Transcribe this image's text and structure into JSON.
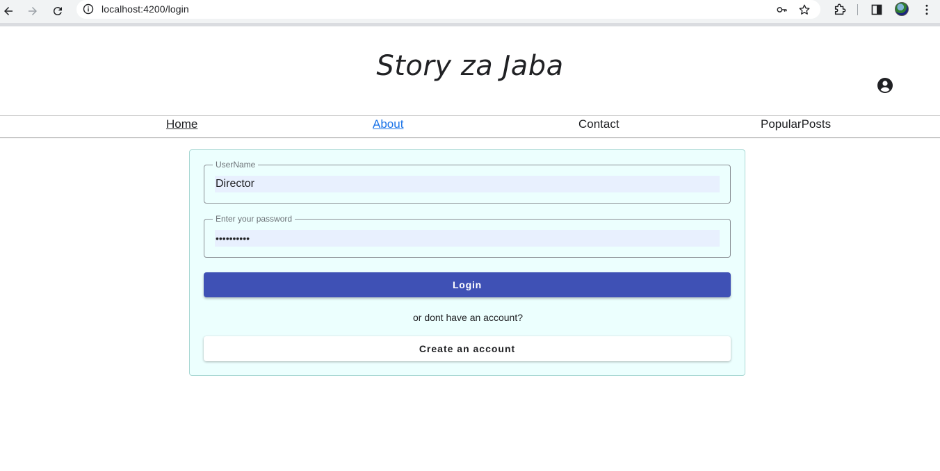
{
  "browser": {
    "url": "localhost:4200/login",
    "icons": [
      "back-icon",
      "forward-icon",
      "reload-icon",
      "site-info-icon",
      "password-key-icon",
      "bookmark-star-icon",
      "extensions-icon",
      "side-panel-icon",
      "profile-avatar",
      "menu-dots-icon"
    ]
  },
  "site": {
    "title": "Story za Jaba",
    "account_icon": "account-circle-icon"
  },
  "nav": {
    "items": [
      {
        "label": "Home"
      },
      {
        "label": "About"
      },
      {
        "label": "Contact"
      },
      {
        "label": "PopularPosts"
      }
    ]
  },
  "login": {
    "username_label": "UserName",
    "username_value": "Director",
    "password_label": "Enter your password",
    "password_value": "••••••••••",
    "login_button": "Login",
    "or_text": "or dont have an account?",
    "create_button": "Create an account"
  },
  "colors": {
    "primary": "#3f51b5",
    "card_background": "#ecfffe",
    "autofill_background": "#e8f0fe",
    "link_active": "#1a73e8"
  }
}
